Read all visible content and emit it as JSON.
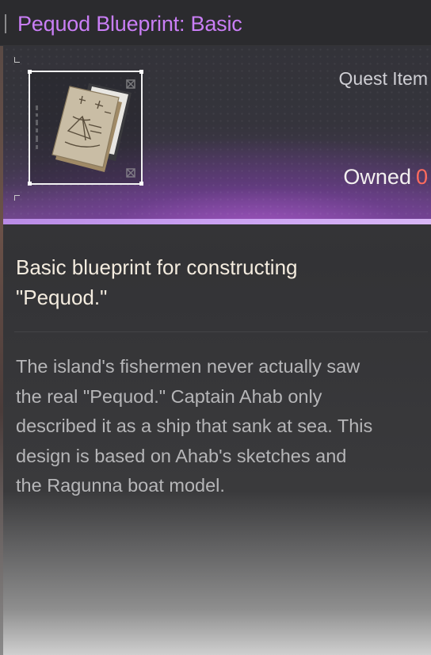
{
  "item": {
    "name": "Pequod Blueprint: Basic",
    "type_label": "Quest Item",
    "owned_label": "Owned",
    "owned_count": "0",
    "icon": "blueprint-papers-icon",
    "short_description": "Basic blueprint for constructing\n \"Pequod.\"",
    "lore": "The island's fishermen never actually saw\nthe real \"Pequod.\" Captain Ahab only\ndescribed it as a ship that sank at sea. This\ndesign is based on Ahab's sketches and\nthe Ragunna boat model."
  },
  "colors": {
    "title": "#c97ef5",
    "accent_bar": "#caa1f2",
    "owned_count": "#ff6b5e",
    "short_description": "#f4ecdf",
    "lore": "#b6b6b8"
  }
}
